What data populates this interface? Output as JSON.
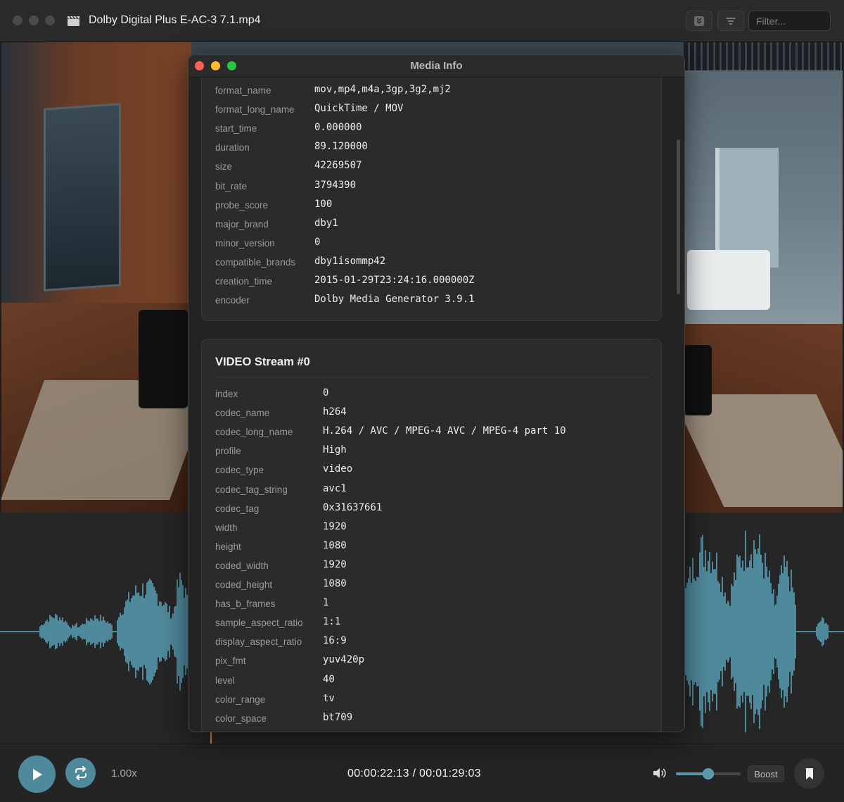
{
  "window": {
    "title": "Dolby Digital Plus E-AC-3 7.1.mp4",
    "title_icon": "clapperboard-icon",
    "filter_placeholder": "Filter..."
  },
  "media_info": {
    "title": "Media Info",
    "format": [
      {
        "key": "format_name",
        "value": "mov,mp4,m4a,3gp,3g2,mj2"
      },
      {
        "key": "format_long_name",
        "value": "QuickTime / MOV"
      },
      {
        "key": "start_time",
        "value": "0.000000"
      },
      {
        "key": "duration",
        "value": "89.120000"
      },
      {
        "key": "size",
        "value": "42269507"
      },
      {
        "key": "bit_rate",
        "value": "3794390"
      },
      {
        "key": "probe_score",
        "value": "100"
      },
      {
        "key": "major_brand",
        "value": "dby1"
      },
      {
        "key": "minor_version",
        "value": "0"
      },
      {
        "key": "compatible_brands",
        "value": "dby1isommp42"
      },
      {
        "key": "creation_time",
        "value": "2015-01-29T23:24:16.000000Z"
      },
      {
        "key": "encoder",
        "value": "Dolby Media Generator 3.9.1"
      }
    ],
    "video_stream": {
      "title": "VIDEO Stream #0",
      "rows": [
        {
          "key": "index",
          "value": "0"
        },
        {
          "key": "codec_name",
          "value": "h264"
        },
        {
          "key": "codec_long_name",
          "value": "H.264 / AVC / MPEG-4 AVC / MPEG-4 part 10"
        },
        {
          "key": "profile",
          "value": "High"
        },
        {
          "key": "codec_type",
          "value": "video"
        },
        {
          "key": "codec_tag_string",
          "value": "avc1"
        },
        {
          "key": "codec_tag",
          "value": "0x31637661"
        },
        {
          "key": "width",
          "value": "1920"
        },
        {
          "key": "height",
          "value": "1080"
        },
        {
          "key": "coded_width",
          "value": "1920"
        },
        {
          "key": "coded_height",
          "value": "1080"
        },
        {
          "key": "has_b_frames",
          "value": "1"
        },
        {
          "key": "sample_aspect_ratio",
          "value": "1:1"
        },
        {
          "key": "display_aspect_ratio",
          "value": "16:9"
        },
        {
          "key": "pix_fmt",
          "value": "yuv420p"
        },
        {
          "key": "level",
          "value": "40"
        },
        {
          "key": "color_range",
          "value": "tv"
        },
        {
          "key": "color_space",
          "value": "bt709"
        }
      ]
    }
  },
  "controls": {
    "speed": "1.00x",
    "timecode": "00:00:22:13 / 00:01:29:03",
    "volume_fraction": 0.5,
    "boost_label": "Boost"
  },
  "colors": {
    "accent": "#4f8a9c",
    "waveform": "#4f8a9c",
    "playhead": "#e0883a"
  }
}
